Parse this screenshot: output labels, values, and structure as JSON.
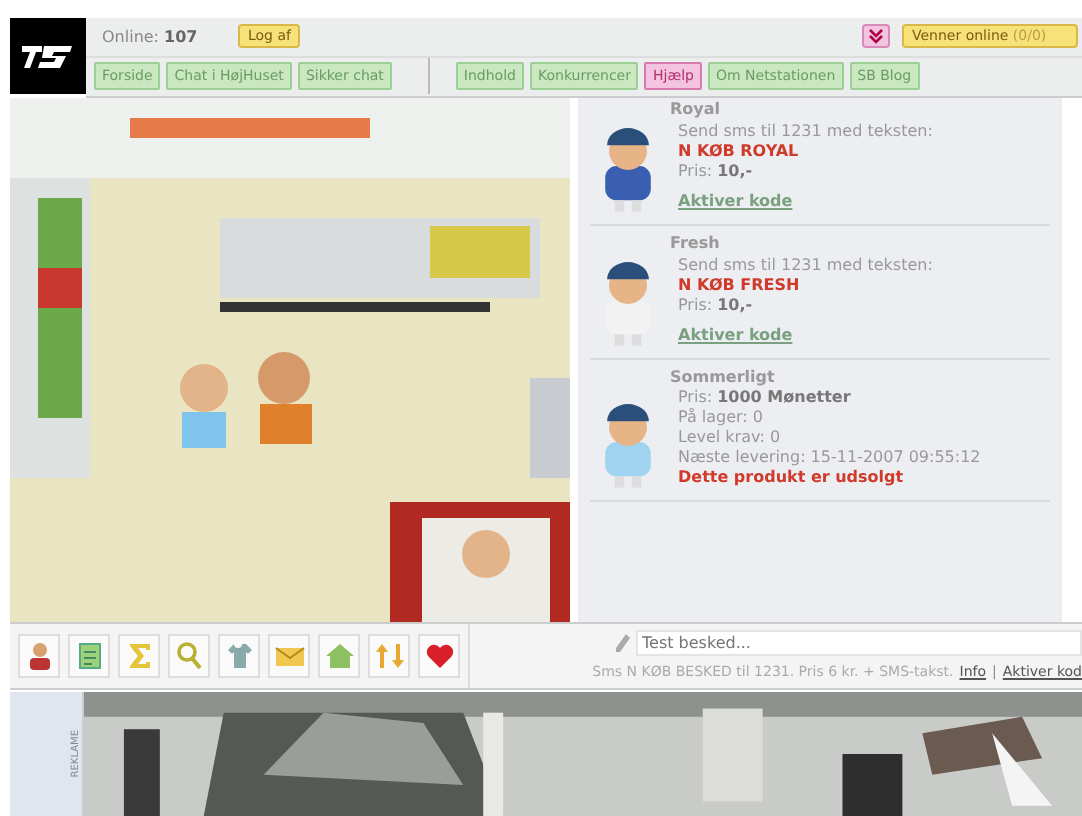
{
  "header": {
    "online_label": "Online:",
    "online_count": "107",
    "logout": "Log af",
    "friends": {
      "label": "Venner online",
      "count": "(0/0)"
    }
  },
  "nav_left": [
    {
      "label": "Forside",
      "selected": false
    },
    {
      "label": "Chat i HøjHuset",
      "selected": false
    },
    {
      "label": "Sikker chat",
      "selected": false
    }
  ],
  "nav_right": [
    {
      "label": "Indhold",
      "selected": false
    },
    {
      "label": "Konkurrencer",
      "selected": false
    },
    {
      "label": "Hjælp",
      "selected": true
    },
    {
      "label": "Om Netstationen",
      "selected": false
    },
    {
      "label": "SB Blog",
      "selected": false
    }
  ],
  "products": [
    {
      "kind": "sms",
      "title": "Royal",
      "color": "#3b5fb0",
      "intro": "Send sms til 1231 med teksten:",
      "code": "N KØB ROYAL",
      "price_label": "Pris:",
      "price": "10,-",
      "link": "Aktiver kode"
    },
    {
      "kind": "sms",
      "title": "Fresh",
      "color": "#f2f2f2",
      "intro": "Send sms til 1231 med teksten:",
      "code": "N KØB FRESH",
      "price_label": "Pris:",
      "price": "10,-",
      "link": "Aktiver kode"
    },
    {
      "kind": "coins",
      "title": "Sommerligt",
      "color": "#9fd3f0",
      "price_label": "Pris:",
      "price": "1000 Mønetter",
      "stock": "På lager: 0",
      "level": "Level krav: 0",
      "delivery": "Næste levering: 15-11-2007 09:55:12",
      "soldout": "Dette produkt er udsolgt"
    }
  ],
  "tools": [
    {
      "kind": "person"
    },
    {
      "kind": "notes"
    },
    {
      "kind": "sigma"
    },
    {
      "kind": "search"
    },
    {
      "kind": "shirt"
    },
    {
      "kind": "mail"
    },
    {
      "kind": "home"
    },
    {
      "kind": "arrows"
    },
    {
      "kind": "heart"
    }
  ],
  "message": {
    "placeholder": "Test besked...",
    "hint": "Sms N KØB BESKED til 1231. Pris 6 kr. + SMS-takst.",
    "info": "Info",
    "separator": "|",
    "activate": "Aktiver kod"
  },
  "ad": {
    "label": "REKLAME"
  }
}
